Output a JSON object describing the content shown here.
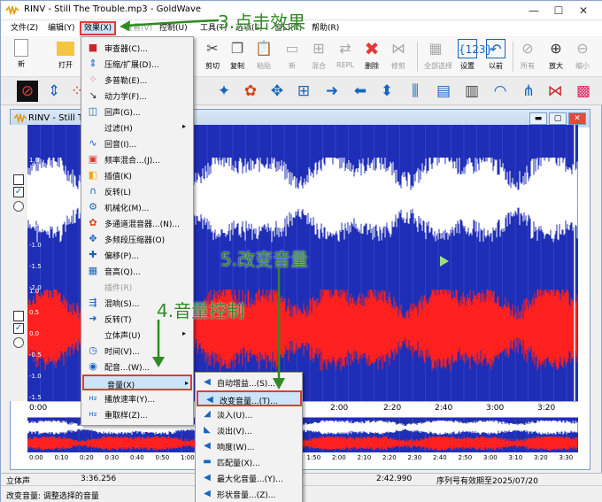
{
  "window": {
    "title": "RINV - Still The Trouble.mp3 - GoldWave",
    "controls": [
      "—",
      "☐",
      "✕"
    ]
  },
  "menubar": [
    {
      "label": "文件(Z)"
    },
    {
      "label": "编辑(Y)"
    },
    {
      "label": "效果(X)"
    },
    {
      "label": "查看(V)"
    },
    {
      "label": "控制(U)"
    },
    {
      "label": "工具(T)"
    },
    {
      "label": "选项(S)"
    },
    {
      "label": "窗口(R)"
    },
    {
      "label": "帮助(R)"
    }
  ],
  "toolbar": [
    {
      "label": "新",
      "icon": "new-file-icon"
    },
    {
      "label": "打开",
      "icon": "open-folder-icon"
    },
    {
      "label": "剪切",
      "icon": "scissors-icon"
    },
    {
      "label": "复制",
      "icon": "copy-icon"
    },
    {
      "label": "粘贴",
      "icon": "paste-icon"
    },
    {
      "label": "新",
      "icon": "paste-new-icon"
    },
    {
      "label": "混合",
      "icon": "mix-icon"
    },
    {
      "label": "REPL",
      "icon": "replace-icon"
    },
    {
      "label": "删除",
      "icon": "delete-x-icon"
    },
    {
      "label": "修剪",
      "icon": "trim-icon"
    },
    {
      "label": "全部选择",
      "icon": "select-all-icon"
    },
    {
      "label": "设置",
      "icon": "set-icon"
    },
    {
      "label": "以前",
      "icon": "previous-icon"
    },
    {
      "label": "所有",
      "icon": "zoom-all-icon"
    },
    {
      "label": "放大",
      "icon": "zoom-in-icon"
    },
    {
      "label": "缩小",
      "icon": "zoom-out-icon"
    }
  ],
  "effects_menu": [
    {
      "label": "审查器(C)...",
      "icon": "inspector-icon"
    },
    {
      "label": "压缩/扩展(D)...",
      "icon": "compress-icon"
    },
    {
      "label": "多普勒(E)...",
      "icon": "doppler-icon"
    },
    {
      "label": "动力学(F)...",
      "icon": "dynamics-icon"
    },
    {
      "label": "回声(G)...",
      "icon": "echo-icon"
    },
    {
      "label": "过滤(H)",
      "icon": "",
      "submenu": true
    },
    {
      "label": "回音(I)...",
      "icon": "reverb-icon"
    },
    {
      "label": "频率混合...(J)...",
      "icon": "freq-mix-icon"
    },
    {
      "label": "插值(K)",
      "icon": "interpolate-icon"
    },
    {
      "label": "反转(L)",
      "icon": "invert-icon"
    },
    {
      "label": "机械化(M)...",
      "icon": "mechanize-icon"
    },
    {
      "label": "多通道混音器...(N)...",
      "icon": "channel-mixer-icon"
    },
    {
      "label": "多频段压缩器(O)",
      "icon": "multiband-icon"
    },
    {
      "label": "偏移(P)...",
      "icon": "offset-icon"
    },
    {
      "label": "音高(Q)...",
      "icon": "pitch-icon"
    },
    {
      "label": "插件(R)",
      "icon": "",
      "disabled": true
    },
    {
      "label": "混响(S)...",
      "icon": "reverb2-icon"
    },
    {
      "label": "反转(T)",
      "icon": "reverse-icon"
    },
    {
      "label": "立体声(U)",
      "icon": "",
      "submenu": true
    },
    {
      "label": "时间(V)...",
      "icon": "time-icon"
    },
    {
      "label": "配音...(W)...",
      "icon": "voiceover-icon"
    },
    {
      "label": "音量(X)",
      "icon": "",
      "submenu": true,
      "highlighted": true
    },
    {
      "label": "播放速率(Y)...",
      "icon": "playback-rate-icon"
    },
    {
      "label": "重取样(Z)...",
      "icon": "resample-icon"
    }
  ],
  "volume_menu": [
    {
      "label": "自动增益...(S)...",
      "icon": "auto-gain-icon"
    },
    {
      "label": "改变音量...(T)...",
      "icon": "change-volume-icon",
      "highlighted": true
    },
    {
      "label": "淡入(U)...",
      "icon": "fade-in-icon"
    },
    {
      "label": "淡出(V)...",
      "icon": "fade-out-icon"
    },
    {
      "label": "响度(W)...",
      "icon": "loudness-icon"
    },
    {
      "label": "匹配量(X)...",
      "icon": "match-volume-icon"
    },
    {
      "label": "最大化音量...(Y)...",
      "icon": "maximize-icon"
    },
    {
      "label": "形状音量...(Z)...",
      "icon": "shape-volume-icon"
    }
  ],
  "inner_window": {
    "title": "RINV - Still The Trouble.mp3"
  },
  "amplitude_labels": {
    "top": [
      "1.0",
      "0.5",
      "0.0",
      "-0.5",
      "-1.0",
      "-1.5",
      "-2.0"
    ],
    "bottom": [
      "1.0",
      "0.5",
      "0.0",
      "-0.5",
      "-1.0",
      "-1.5"
    ]
  },
  "timeline": [
    "0:00",
    "2:00",
    "2:20",
    "2:40",
    "3:00",
    "3:20"
  ],
  "overview_timeline": [
    "0:00",
    "0:10",
    "0:20",
    "0:30",
    "0:40",
    "0:50",
    "1:00",
    "1:10",
    "1:20",
    "1:30",
    "1:40",
    "1:50",
    "2:00",
    "2:10",
    "2:20",
    "2:30",
    "2:40",
    "2:50",
    "3:00",
    "3:10",
    "3:20",
    "3:30"
  ],
  "status1": {
    "channels": "立体声",
    "length": "3:36.256",
    "position": "2:42.990",
    "license": "序列号有效期至2025/07/20"
  },
  "status2": {
    "hint": "改变音量: 调整选择的音量"
  },
  "annotations": {
    "step3": "3.点击效果",
    "step4": "4.音量控制",
    "step5": "5.改变音量"
  },
  "colors": {
    "wave_bg": "#1f2eb6",
    "wave_top": "#ffffff",
    "wave_bottom": "#ff2020",
    "annotation": "#2e8b22",
    "highlight_border": "#e53935"
  }
}
